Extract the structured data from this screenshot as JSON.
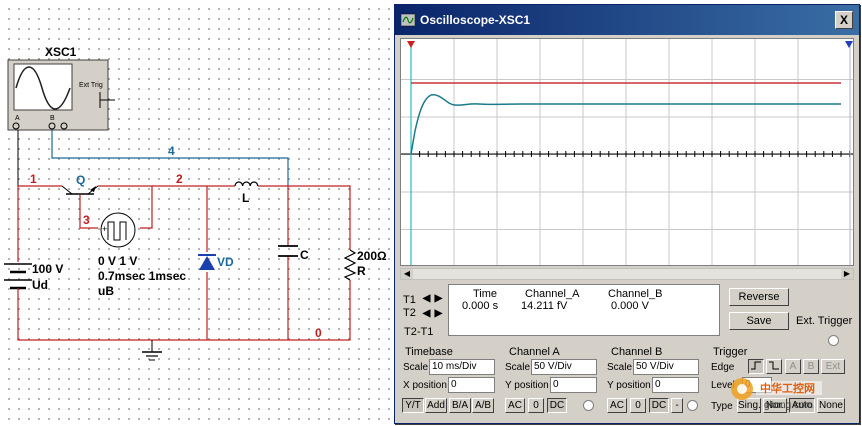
{
  "schematic": {
    "instrument_name": "XSC1",
    "ext_trig_label": "Ext Trig",
    "port_a": "A",
    "port_b": "B",
    "net_1": "1",
    "net_2": "2",
    "net_3": "3",
    "net_4": "4",
    "net_0": "0",
    "transistor_label": "Q",
    "inductor_label": "L",
    "capacitor_label": "C",
    "resistor_value": "200Ω",
    "resistor_label": "R",
    "diode_label": "VD",
    "source_value": "100 V",
    "source_label": "Ud",
    "pulse_line1": "0 V 1 V",
    "pulse_line2": "0.7msec 1msec",
    "pulse_label": "uB"
  },
  "scope": {
    "title": "Oscilloscope-XSC1",
    "close_glyph": "X",
    "colors": {
      "trace_a": "#1a7a8a",
      "trace_b": "#c8323c",
      "cursor_1": "#cc2020",
      "cursor_2": "#2040c0"
    },
    "readout": {
      "t1": "T1",
      "t2": "T2",
      "t2t1": "T2-T1",
      "headers": {
        "time": "Time",
        "channel_a": "Channel_A",
        "channel_b": "Channel_B"
      },
      "values": {
        "time": "0.000 s",
        "channel_a": "14.211 fV",
        "channel_b": "0.000 V"
      }
    },
    "buttons": {
      "reverse": "Reverse",
      "save": "Save",
      "ext_trigger": "Ext. Trigger"
    },
    "timebase": {
      "title": "Timebase",
      "scale_label": "Scale",
      "scale_value": "10 ms/Div",
      "xpos_label": "X position",
      "xpos_value": "0",
      "yt": "Y/T",
      "add": "Add",
      "ba": "B/A",
      "ab": "A/B"
    },
    "channel_a": {
      "title": "Channel A",
      "scale_label": "Scale",
      "scale_value": "50  V/Div",
      "ypos_label": "Y position",
      "ypos_value": "0",
      "ac": "AC",
      "zero": "0",
      "dc": "DC"
    },
    "channel_b": {
      "title": "Channel B",
      "scale_label": "Scale",
      "scale_value": "50  V/Div",
      "ypos_label": "Y position",
      "ypos_value": "0",
      "ac": "AC",
      "zero": "0",
      "dc": "DC",
      "minus": "-"
    },
    "trigger": {
      "title": "Trigger",
      "edge_label": "Edge",
      "level_label": "Level",
      "level_value": "0",
      "a": "A",
      "b": "B",
      "ext": "Ext",
      "type_label": "Type",
      "sing": "Sing.",
      "nor": "Nor.",
      "auto": "Auto",
      "none": "None"
    }
  },
  "watermark": {
    "line1": "中华工控网",
    "line2": "gkong.com"
  }
}
